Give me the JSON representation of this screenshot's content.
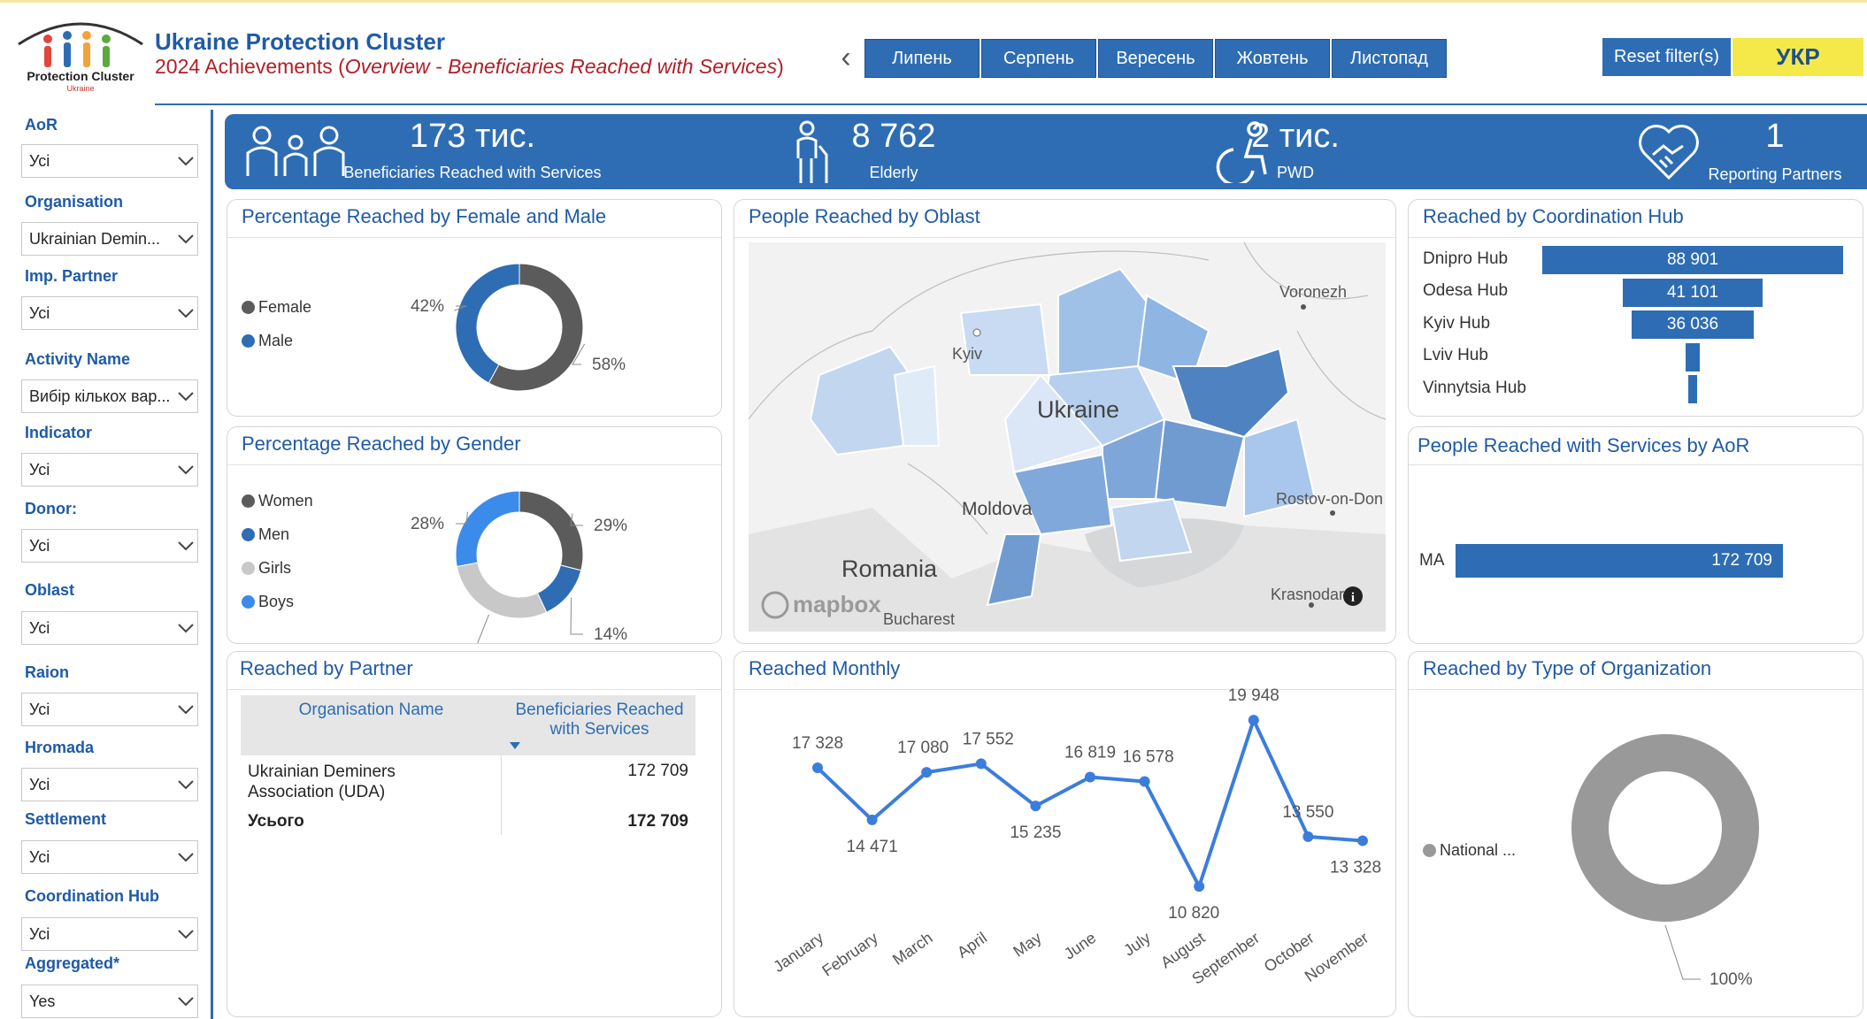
{
  "header": {
    "logo_text": "Protection Cluster",
    "logo_subtext": "Ukraine",
    "title": "Ukraine Protection Cluster",
    "subtitle_prefix": "2024 Achievements (",
    "subtitle_italic": "Overview - Beneficiaries Reached with Services",
    "subtitle_suffix": ")",
    "months": [
      "Липень",
      "Серпень",
      "Вересень",
      "Жовтень",
      "Листопад"
    ],
    "reset_label": "Reset filter(s)",
    "language_label": "УКР"
  },
  "filters": [
    {
      "label": "AoR",
      "value": "Усі"
    },
    {
      "label": "Organisation",
      "value": "Ukrainian Demin..."
    },
    {
      "label": "Imp. Partner",
      "value": "Усі"
    },
    {
      "label": "Activity Name",
      "value": "Вибір кількох вар..."
    },
    {
      "label": "Indicator",
      "value": "Усі"
    },
    {
      "label": "Donor:",
      "value": "Усі"
    },
    {
      "label": "Oblast",
      "value": "Усі"
    },
    {
      "label": "Raion",
      "value": "Усі"
    },
    {
      "label": "Hromada",
      "value": "Усі"
    },
    {
      "label": "Settlement",
      "value": "Усі"
    },
    {
      "label": "Coordination Hub",
      "value": "Усі"
    },
    {
      "label": "Aggregated*",
      "value": "Yes"
    }
  ],
  "kpis": [
    {
      "value": "173 тис.",
      "label": "Beneficiaries Reached with Services",
      "icon": "family-icon"
    },
    {
      "value": "8 762",
      "label": "Elderly",
      "icon": "elderly-person-icon"
    },
    {
      "value": "2 тис.",
      "label": "PWD",
      "icon": "wheelchair-icon"
    },
    {
      "value": "1",
      "label": "Reporting Partners",
      "icon": "handshake-heart-icon"
    }
  ],
  "panels": {
    "female_male": {
      "title": "Percentage Reached by Female and Male"
    },
    "gender": {
      "title": "Percentage Reached by Gender"
    },
    "oblast_map": {
      "title": "People Reached by Oblast",
      "labels": [
        "Voronezh",
        "Kyiv",
        "Ukraine",
        "Moldova",
        "Romania",
        "Rostov-on-Don",
        "Krasnodar",
        "Bucharest",
        "mapbox"
      ]
    },
    "hub": {
      "title": "Reached by Coordination Hub"
    },
    "aor": {
      "title": "People Reached with Services by AoR"
    },
    "partner": {
      "title": "Reached by Partner",
      "col_org": "Organisation Name",
      "col_benef": "Beneficiaries Reached with Services",
      "rows": [
        {
          "org": "Ukrainian Deminers Association (UDA)",
          "value": "172 709"
        }
      ],
      "total_label": "Усього",
      "total_value": "172 709"
    },
    "monthly": {
      "title": "Reached Monthly"
    },
    "org_type": {
      "title": "Reached by Type of Organization"
    }
  },
  "chart_data": [
    {
      "type": "pie",
      "title": "Percentage Reached by Female and Male",
      "categories": [
        "Female",
        "Male"
      ],
      "values": [
        58,
        42
      ],
      "value_labels": [
        "58%",
        "42%"
      ],
      "colors": [
        "#5b5b5b",
        "#2e6db4"
      ],
      "legend": "left"
    },
    {
      "type": "pie",
      "title": "Percentage Reached by Gender",
      "categories": [
        "Women",
        "Men",
        "Girls",
        "Boys"
      ],
      "values": [
        29,
        14,
        29,
        28
      ],
      "value_labels": [
        "29%",
        "14%",
        "29%",
        "28%"
      ],
      "colors": [
        "#5b5b5b",
        "#2e6db4",
        "#c8c8c8",
        "#3b8beb"
      ],
      "legend": "left"
    },
    {
      "type": "bar",
      "title": "Reached by Coordination Hub",
      "categories": [
        "Dnipro Hub",
        "Odesa Hub",
        "Kyiv Hub",
        "Lviv Hub",
        "Vinnytsia Hub"
      ],
      "values": [
        88901,
        41101,
        36036,
        4000,
        2600
      ],
      "value_labels": [
        "88 901",
        "41 101",
        "36 036",
        "",
        ""
      ],
      "color": "#2e6db4"
    },
    {
      "type": "bar",
      "title": "People Reached with Services by AoR",
      "categories": [
        "MA"
      ],
      "values": [
        172709
      ],
      "value_labels": [
        "172 709"
      ],
      "color": "#2e6db4"
    },
    {
      "type": "line",
      "title": "Reached Monthly",
      "categories": [
        "January",
        "February",
        "March",
        "April",
        "May",
        "June",
        "July",
        "August",
        "September",
        "October",
        "November"
      ],
      "values": [
        17328,
        14471,
        17080,
        17552,
        15235,
        16819,
        16578,
        10820,
        19948,
        13550,
        13328
      ],
      "value_labels": [
        "17 328",
        "14 471",
        "17 080",
        "17 552",
        "15 235",
        "16 819",
        "16 578",
        "10 820",
        "19 948",
        "13 550",
        "13 328"
      ],
      "color": "#3b7ddd"
    },
    {
      "type": "pie",
      "title": "Reached by Type of Organization",
      "categories": [
        "National ..."
      ],
      "values": [
        100
      ],
      "value_labels": [
        "100%"
      ],
      "colors": [
        "#999999"
      ],
      "legend": "left"
    }
  ]
}
